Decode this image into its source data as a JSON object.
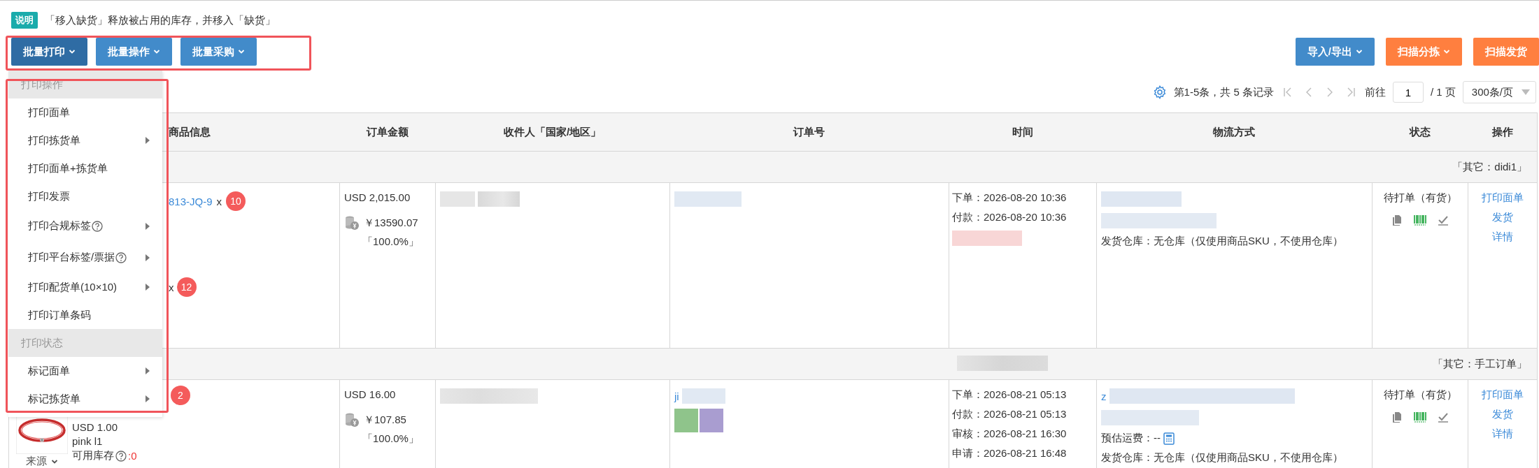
{
  "note": {
    "tag": "说明",
    "text": "「移入缺货」释放被占用的库存，并移入「缺货」"
  },
  "toolbar_left": [
    {
      "label": "批量打印",
      "selected": true
    },
    {
      "label": "批量操作",
      "selected": false
    },
    {
      "label": "批量采购",
      "selected": false
    }
  ],
  "toolbar_right": [
    {
      "label": "导入/导出",
      "kind": "blue",
      "dropdown": true
    },
    {
      "label": "扫描分拣",
      "kind": "orange",
      "dropdown": true
    },
    {
      "label": "扫描发货",
      "kind": "orange",
      "dropdown": false
    }
  ],
  "pagination": {
    "summary": "第1-5条，共 5 条记录",
    "goto_label": "前往",
    "page": "1",
    "total": "/ 1 页",
    "page_size": "300条/页"
  },
  "table": {
    "columns": [
      "商品信息",
      "订单金额",
      "收件人「国家/地区」",
      "订单号",
      "时间",
      "物流方式",
      "状态",
      "操作"
    ],
    "groups": [
      {
        "label": "「其它：didi1」",
        "blurred_time": false,
        "products": [
          {
            "sku": "813-JQ-9",
            "times": "x",
            "qty": "10"
          },
          {
            "times": "x",
            "qty": "12"
          }
        ],
        "amount": "USD 2,015.00",
        "cny": "￥13590.07",
        "ratio": "「100.0%」",
        "times": [
          "下单：2026-08-20 10:36",
          "付款：2026-08-20 10:36"
        ],
        "warehouse": "发货仓库：无仓库（仅使用商品SKU，不使用仓库）",
        "status": "待打单（有货）",
        "actions": [
          "打印面单",
          "发货",
          "详情"
        ]
      },
      {
        "label": "「其它：手工订单」",
        "blurred_time": true,
        "products": [
          {
            "qty": "2",
            "price": "USD 1.00",
            "variant": "pink l1",
            "stock_label": "可用库存",
            "stock": ":0",
            "source": "来源"
          }
        ],
        "amount": "USD 16.00",
        "cny": "￥107.85",
        "ratio": "「100.0%」",
        "order_prefix": "ji",
        "tags": [
          {
            "color": "#8fc48b"
          },
          {
            "color": "#a99dd0"
          }
        ],
        "times": [
          "下单：2026-08-21 05:13",
          "付款：2026-08-21 05:13",
          "审核：2026-08-21 16:30",
          "申请：2026-08-21 16:48"
        ],
        "logistics_prefix": "z",
        "freight": "预估运费：--",
        "warehouse": "发货仓库：无仓库（仅使用商品SKU，不使用仓库）",
        "status": "待打单（有货）",
        "actions": [
          "打印面单",
          "发货",
          "详情"
        ]
      }
    ]
  },
  "dropdown_menu": [
    {
      "header": "打印操作",
      "items": [
        {
          "label": "打印面单",
          "help": false,
          "submenu": false
        },
        {
          "label": "打印拣货单",
          "help": false,
          "submenu": true
        },
        {
          "label": "打印面单+拣货单",
          "help": false,
          "submenu": false
        },
        {
          "label": "打印发票",
          "help": false,
          "submenu": false
        },
        {
          "label": "打印合规标签",
          "help": true,
          "submenu": true
        },
        {
          "label": "打印平台标签/票据",
          "help": true,
          "submenu": true
        },
        {
          "label": "打印配货单(10×10)",
          "help": false,
          "submenu": true
        },
        {
          "label": "打印订单条码",
          "help": false,
          "submenu": false
        }
      ]
    },
    {
      "header": "打印状态",
      "items": [
        {
          "label": "标记面单",
          "help": false,
          "submenu": true
        },
        {
          "label": "标记拣货单",
          "help": false,
          "submenu": true
        }
      ]
    }
  ]
}
